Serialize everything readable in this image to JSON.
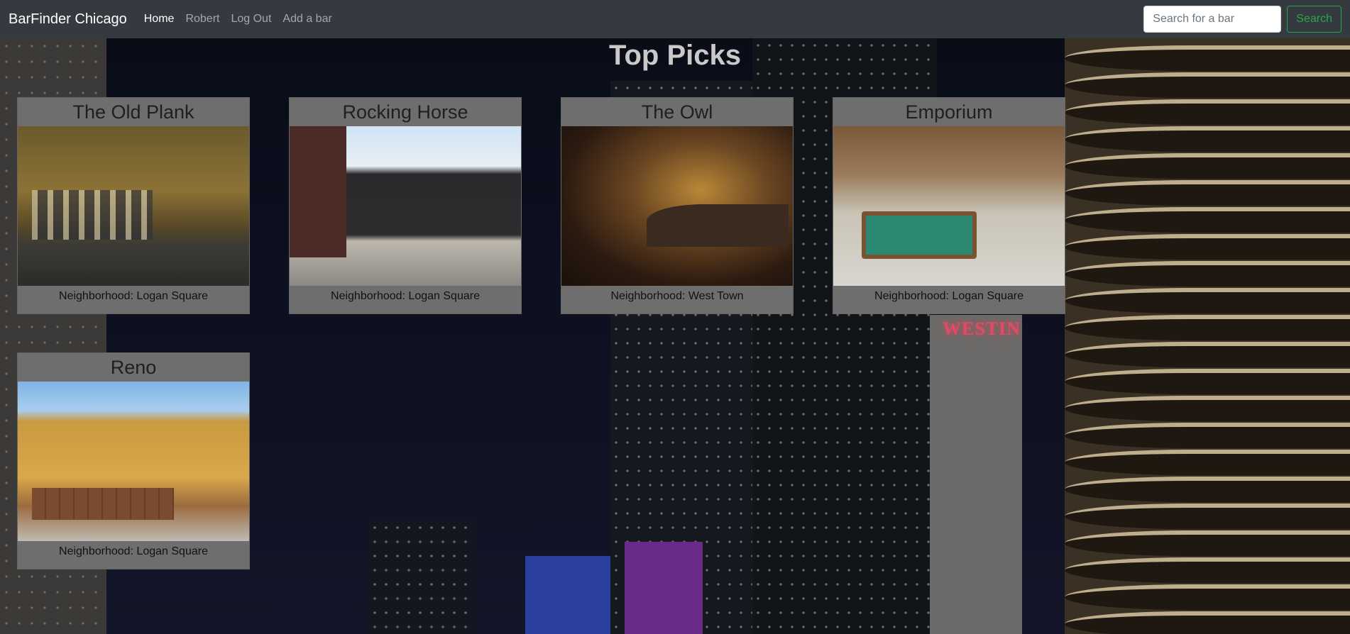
{
  "navbar": {
    "brand": "BarFinder Chicago",
    "links": [
      "Home",
      "Robert",
      "Log Out",
      "Add a bar"
    ],
    "active": "Home",
    "search": {
      "placeholder": "Search for a bar",
      "value": "",
      "button_label": "Search"
    }
  },
  "main": {
    "title": "Top Picks",
    "bars": [
      {
        "name": "The Old Plank",
        "caption": "Neighborhood: Logan Square"
      },
      {
        "name": "Rocking Horse",
        "caption": "Neighborhood: Logan Square"
      },
      {
        "name": "The Owl",
        "caption": "Neighborhood: West Town"
      },
      {
        "name": "Emporium",
        "caption": "Neighborhood: Logan Square"
      },
      {
        "name": "Reno",
        "caption": "Neighborhood: Logan Square"
      }
    ]
  },
  "background": {
    "sign_text": "WESTIN"
  },
  "colors": {
    "navbar": "#343a40",
    "search_accent": "#28a745",
    "card": "#6e6e6e"
  }
}
